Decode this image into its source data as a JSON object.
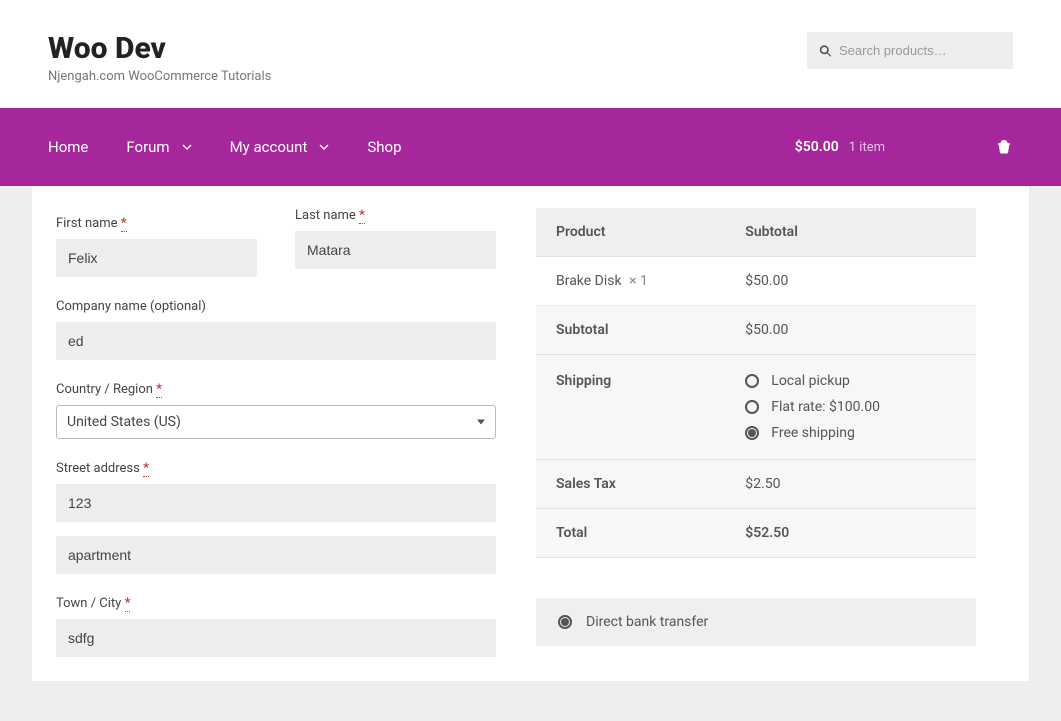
{
  "header": {
    "title": "Woo Dev",
    "subtitle": "Njengah.com WooCommerce Tutorials",
    "search_placeholder": "Search products…"
  },
  "nav": {
    "items": [
      {
        "label": "Home",
        "has_sub": false
      },
      {
        "label": "Forum",
        "has_sub": true
      },
      {
        "label": "My account",
        "has_sub": true
      },
      {
        "label": "Shop",
        "has_sub": false
      }
    ],
    "cart_total": "$50.00",
    "cart_items": "1 item"
  },
  "billing": {
    "first_name": {
      "label": "First name",
      "required": true,
      "value": "Felix"
    },
    "last_name": {
      "label": "Last name",
      "required": true,
      "value": "Matara"
    },
    "company": {
      "label": "Company name (optional)",
      "required": false,
      "value": "ed"
    },
    "country": {
      "label": "Country / Region",
      "required": true,
      "value": "United States (US)"
    },
    "street": {
      "label": "Street address",
      "required": true,
      "value": "123"
    },
    "street2": {
      "value": "apartment"
    },
    "city": {
      "label": "Town / City",
      "required": true,
      "value": "sdfg"
    }
  },
  "order": {
    "headers": {
      "product": "Product",
      "subtotal": "Subtotal"
    },
    "line": {
      "name": "Brake Disk",
      "qty": "× 1",
      "price": "$50.00"
    },
    "subtotal": {
      "label": "Subtotal",
      "value": "$50.00"
    },
    "shipping": {
      "label": "Shipping",
      "options": [
        {
          "label": "Local pickup",
          "checked": false
        },
        {
          "label": "Flat rate: $100.00",
          "checked": false
        },
        {
          "label": "Free shipping",
          "checked": true
        }
      ]
    },
    "tax": {
      "label": "Sales Tax",
      "value": "$2.50"
    },
    "total": {
      "label": "Total",
      "value": "$52.50"
    }
  },
  "payment": {
    "option1": "Direct bank transfer"
  },
  "required_marker": "*"
}
